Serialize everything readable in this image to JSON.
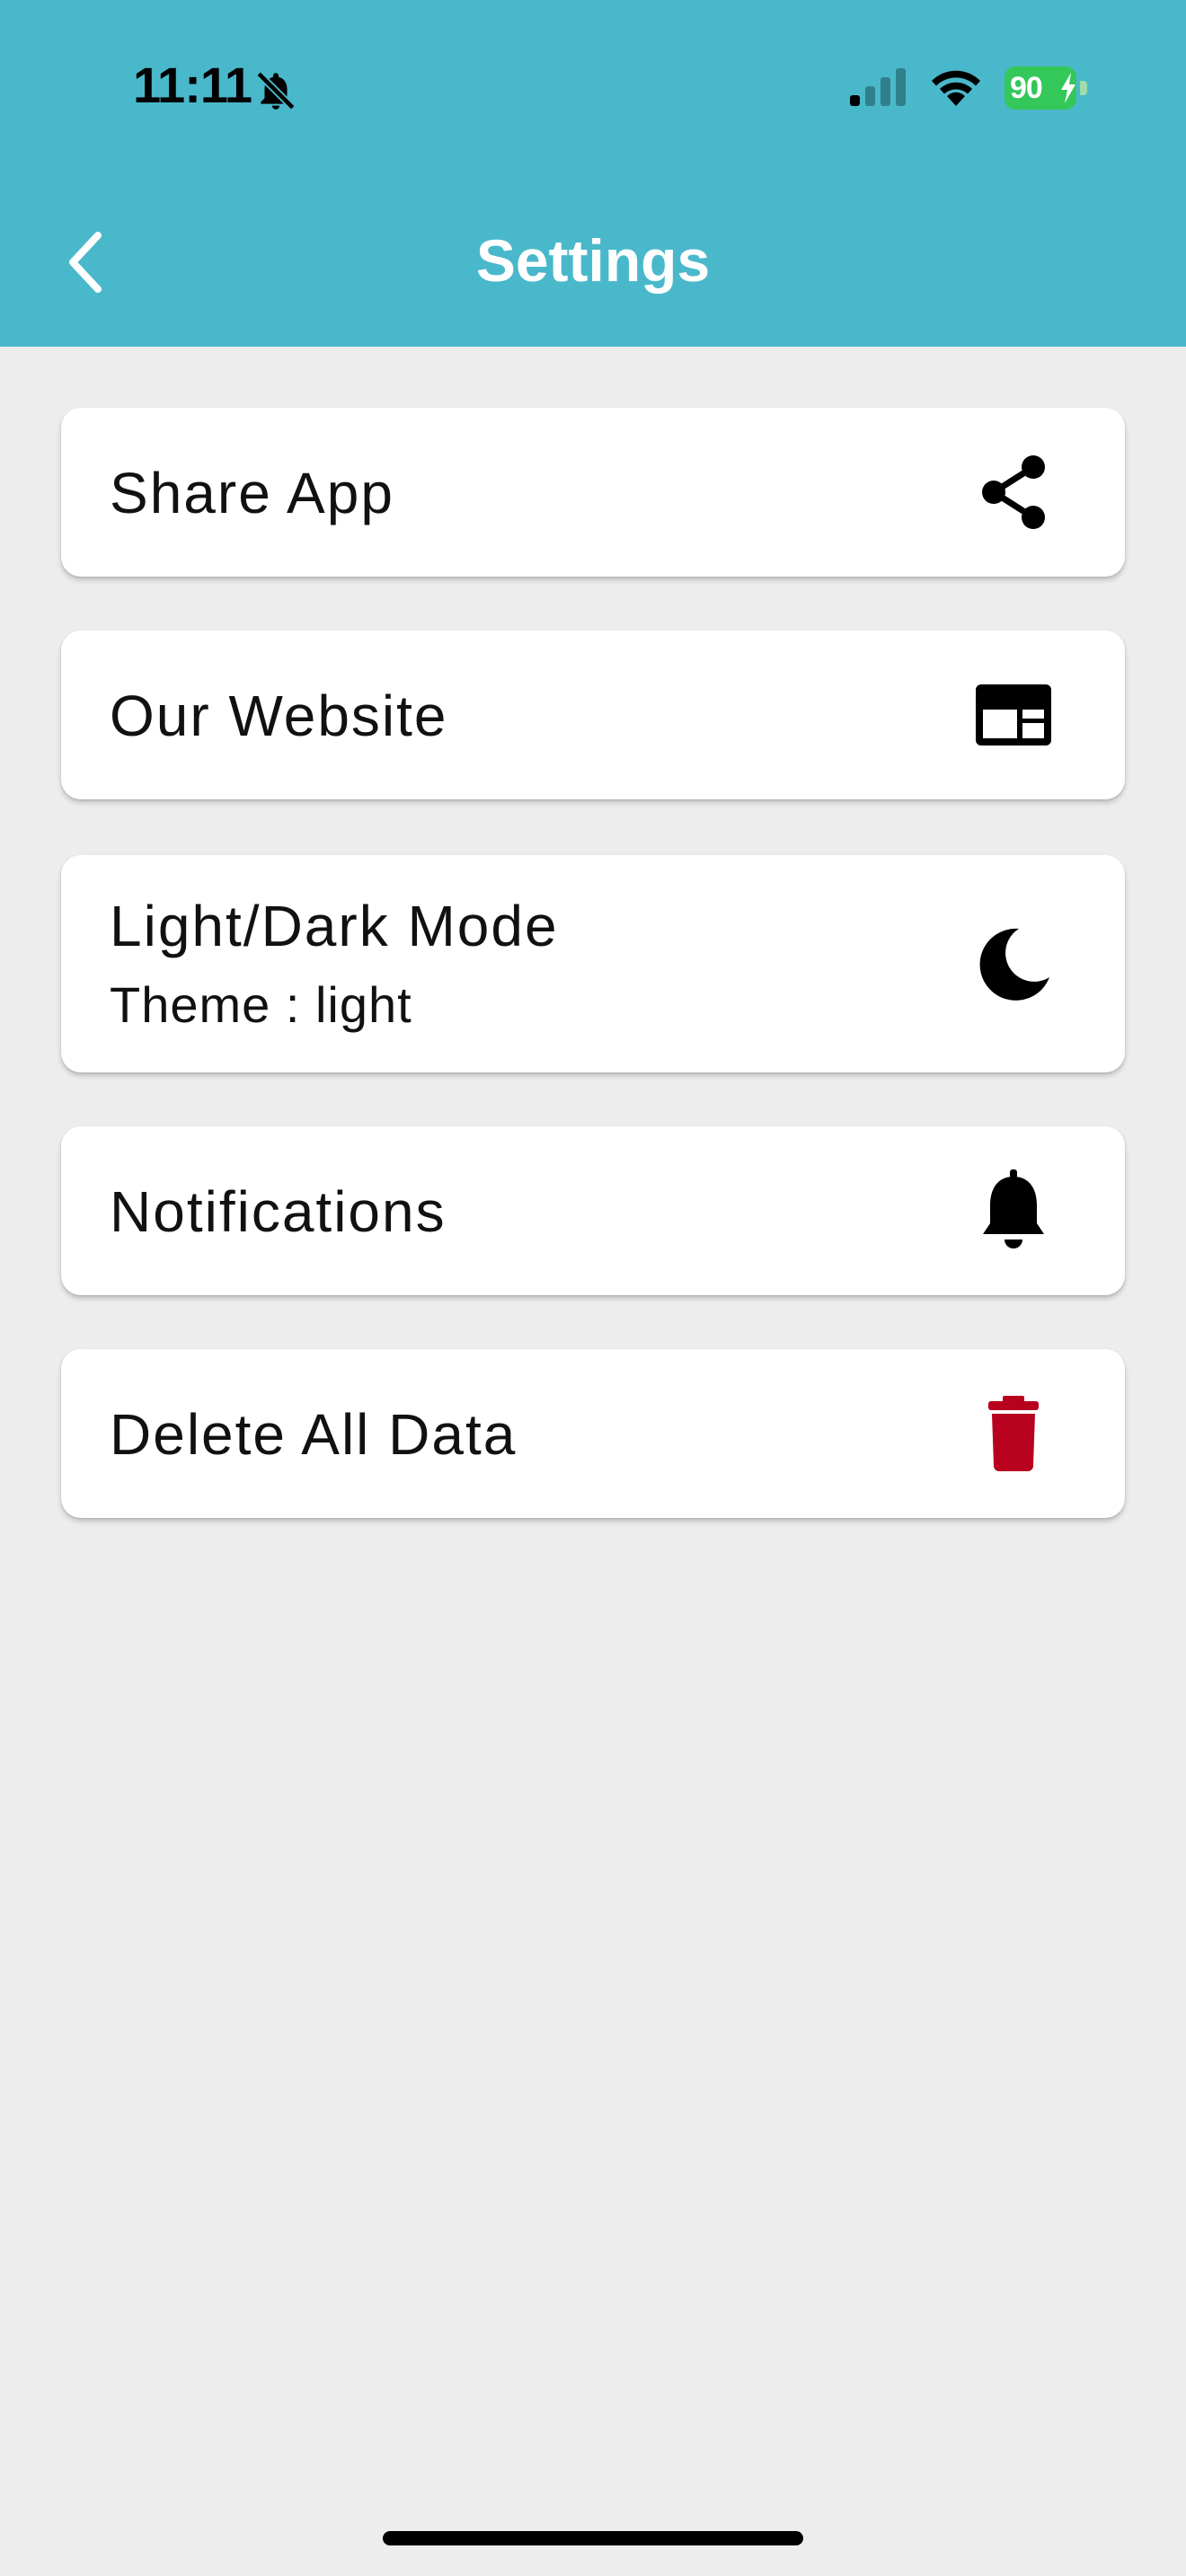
{
  "status_bar": {
    "time": "11:11",
    "battery_level": "90",
    "icons": [
      "bell-off-icon",
      "cellular-signal-icon",
      "wifi-icon",
      "battery-charging-icon"
    ]
  },
  "header": {
    "title": "Settings",
    "back_icon": "chevron-left-icon",
    "background_color": "#4ab8cb"
  },
  "settings": {
    "items": [
      {
        "label": "Share App",
        "icon": "share-icon"
      },
      {
        "label": "Our Website",
        "icon": "website-icon"
      },
      {
        "label": "Light/Dark Mode",
        "subtitle": "Theme : light",
        "icon": "moon-icon"
      },
      {
        "label": "Notifications",
        "icon": "bell-icon"
      },
      {
        "label": "Delete All Data",
        "icon": "trash-icon",
        "icon_color": "#b8001f"
      }
    ]
  }
}
